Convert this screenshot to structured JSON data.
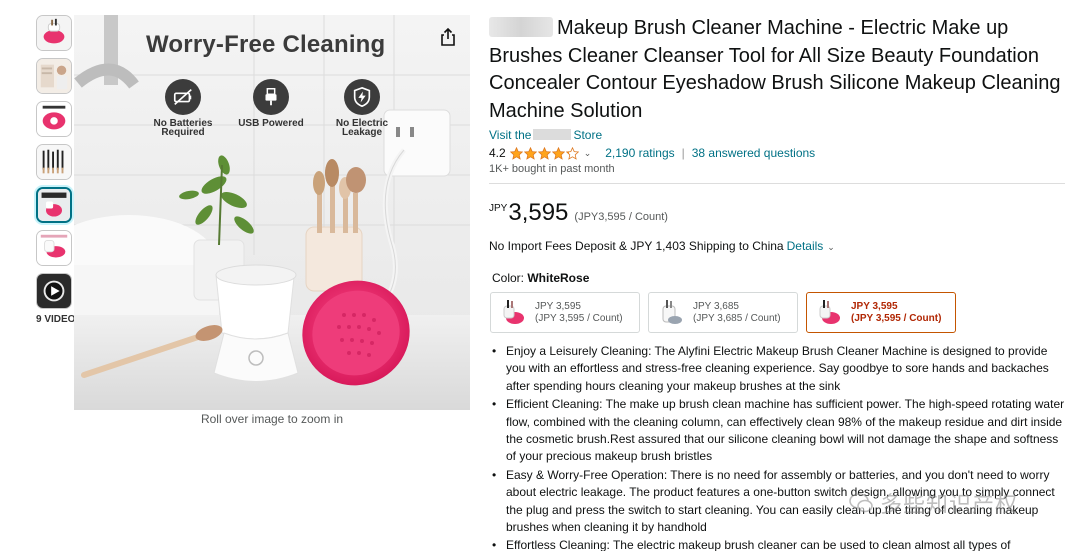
{
  "gallery": {
    "video_label": "9 VIDEOS",
    "zoom_hint": "Roll over image to zoom in",
    "headline": "Worry-Free Cleaning",
    "features": [
      {
        "icon": "no-battery-icon",
        "label_line1": "No Batteries",
        "label_line2": "Required"
      },
      {
        "icon": "usb-plug-icon",
        "label_line1": "USB Powered",
        "label_line2": ""
      },
      {
        "icon": "shield-bolt-icon",
        "label_line1": "No Electric",
        "label_line2": "Leakage"
      }
    ]
  },
  "product": {
    "title": "Makeup Brush Cleaner Machine - Electric Make up Brushes Cleaner Cleanser Tool for All Size Beauty Foundation Concealer Contour Eyeshadow Brush Silicone Makeup Cleaning Machine Solution",
    "store_prefix": "Visit the",
    "store_suffix": "Store",
    "rating": "4.2",
    "stars_fraction": 0.84,
    "ratings_count": "2,190 ratings",
    "answered": "38 answered questions",
    "bought": "1K+ bought in past month",
    "price_currency": "JPY",
    "price_value": "3,595",
    "price_unit": "(JPY3,595 / Count)",
    "shipping_text": "No Import Fees Deposit & JPY 1,403 Shipping to China",
    "shipping_link": "Details",
    "color_label": "Color:",
    "color_value": "WhiteRose",
    "variants": [
      {
        "price": "JPY 3,595",
        "unit": "(JPY 3,595 / Count)",
        "selected": false
      },
      {
        "price": "JPY 3,685",
        "unit": "(JPY 3,685 / Count)",
        "selected": false
      },
      {
        "price": "JPY 3,595",
        "unit": "(JPY 3,595 / Count)",
        "selected": true
      }
    ],
    "bullets": [
      "Enjoy a Leisurely Cleaning: The Alyfini Electric Makeup Brush Cleaner Machine is designed to provide you with an effortless and stress-free cleaning experience. Say goodbye to sore hands and backaches after spending hours cleaning your makeup brushes at the sink",
      "Efficient Cleaning: The make up brush clean machine has sufficient power. The high-speed rotating water flow, combined with the cleaning column, can effectively clean 98% of the makeup residue and dirt inside the cosmetic brush.Rest assured that our silicone cleaning bowl will not damage the shape and softness of your precious makeup brush bristles",
      "Easy & Worry-Free Operation: There is no need for assembly or batteries, and you don't need to worry about electric leakage. The product features a one-button switch design, allowing you to simply connect the plug and press the switch to start cleaning. You can easily clean up the tiring of cleaning makeup brushes when cleaning it by handhold",
      "Effortless Cleaning: The electric makeup brush cleaner can be used to clean almost all types of"
    ]
  },
  "watermark": {
    "text": "多些知识产权"
  },
  "colors": {
    "link": "#007185",
    "price_red": "#B12704",
    "accent_pink": "#E8336E",
    "selected_border": "#C45500",
    "star": "#FFA41C"
  }
}
